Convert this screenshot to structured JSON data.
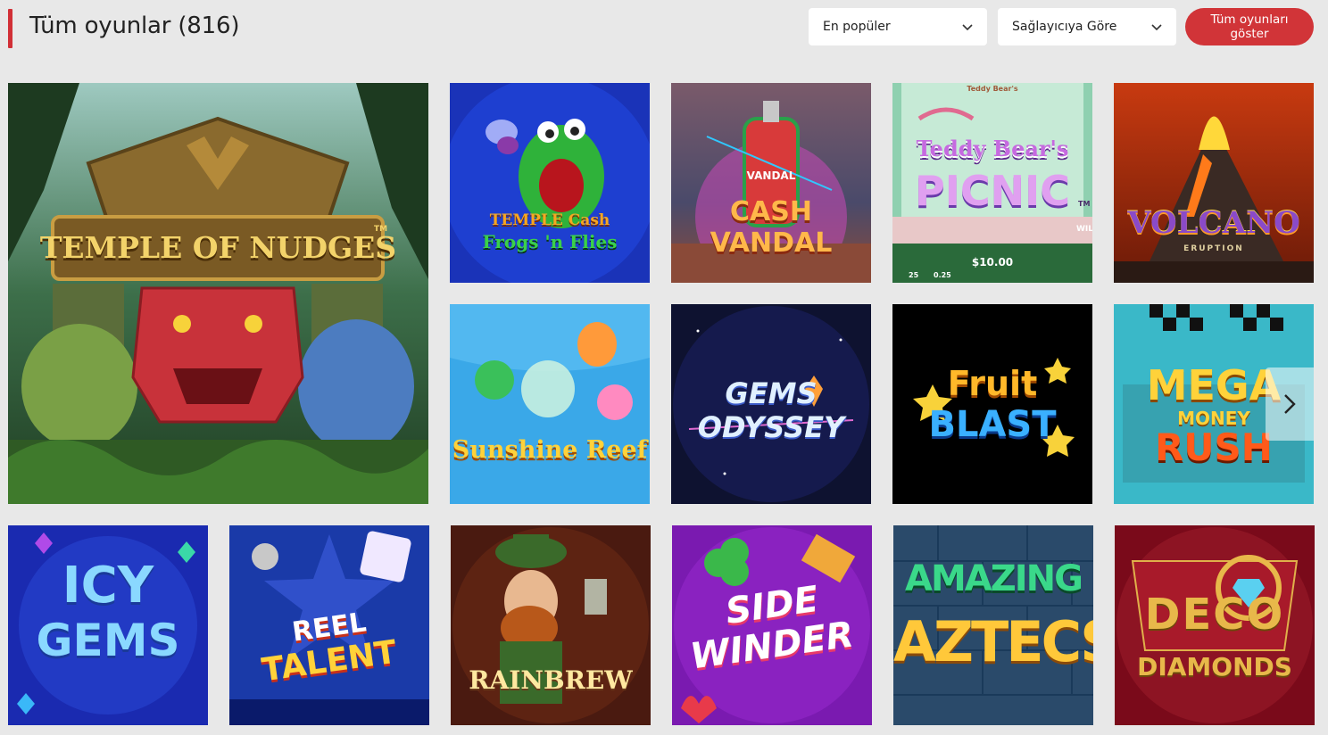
{
  "header": {
    "title": "Tüm oyunlar (816)",
    "sort": {
      "selected": "En popüler"
    },
    "provider": {
      "selected": "Sağlayıcıya Göre"
    },
    "show_all_label": "Tüm oyunları göster"
  },
  "games": [
    {
      "name": "TEMPLE OF NUDGES",
      "tm": "TM"
    },
    {
      "name_line1": "TEMPLE Cash",
      "name_line2": "Frogs 'n Flies"
    },
    {
      "name_line0": "VANDAL",
      "name_line1": "CASH",
      "name_line2": "VANDAL"
    },
    {
      "name_line0": "Teddy Bear's",
      "name_line1": "Teddy Bear's",
      "name_line2": "PICNIC",
      "tm": "TM",
      "amount": "$10.00",
      "bet_a": "25",
      "bet_b": "0.25",
      "side": "WIL"
    },
    {
      "name": "VOLCANO",
      "sub": "ERUPTION"
    },
    {
      "name": "Sunshine Reef"
    },
    {
      "name_line1": "GEMS",
      "name_line2": "ODYSSEY"
    },
    {
      "name_line1": "Fruit",
      "name_line2": "BLAST"
    },
    {
      "name_line1": "MEGA",
      "name_line2": "MONEY",
      "name_line3": "RUSH"
    },
    {
      "name_line1": "ICY",
      "name_line2": "GEMS"
    },
    {
      "name_line1": "REEL",
      "name_line2": "TALENT"
    },
    {
      "name": "RAINBREW"
    },
    {
      "name_line1": "SIDE",
      "name_line2": "WINDER"
    },
    {
      "name_line1": "AMAZING",
      "name_line2": "AZTECS"
    },
    {
      "name_line1": "DECO",
      "name_line2": "DIAMONDS"
    }
  ]
}
